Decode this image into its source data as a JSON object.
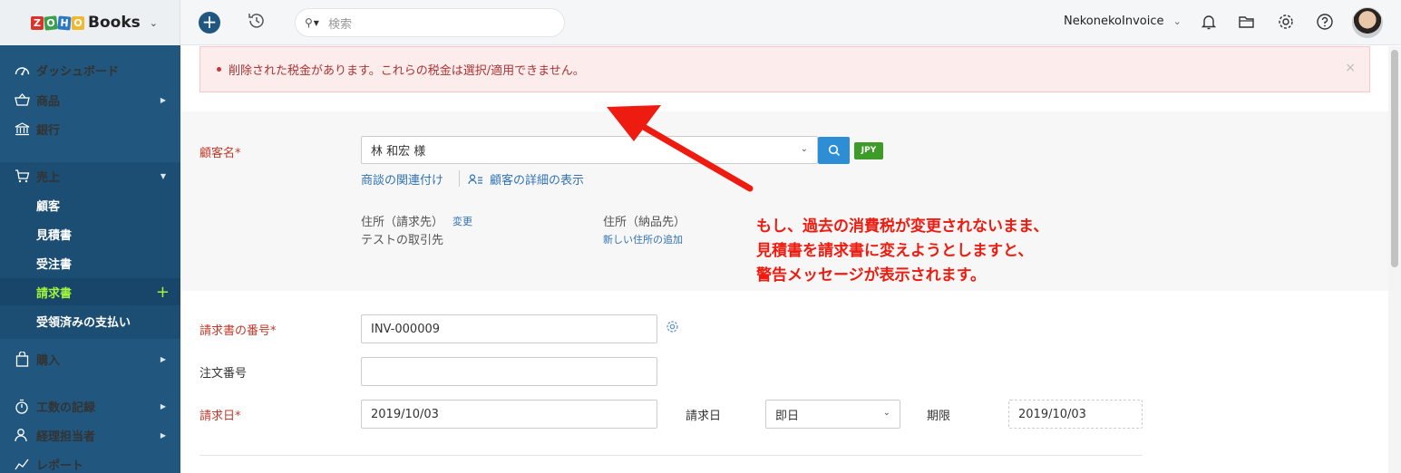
{
  "brand": {
    "logo_letters": [
      "Z",
      "O",
      "H",
      "O"
    ],
    "name": "Books"
  },
  "topbar": {
    "search_placeholder": "検索",
    "organization": "NekonekoInvoice"
  },
  "sidebar": {
    "dashboard": "ダッシュボード",
    "items": "商品",
    "banking": "銀行",
    "sales": "売上",
    "customers": "顧客",
    "estimates": "見積書",
    "sales_orders": "受注書",
    "invoices": "請求書",
    "payments_received": "受領済みの支払い",
    "purchases": "購入",
    "time_tracking": "工数の記録",
    "accountant": "経理担当者",
    "reports": "レポート"
  },
  "alert": {
    "message": "削除された税金があります。これらの税金は選択/適用できません。",
    "close": "×"
  },
  "form": {
    "customer_label": "顧客名*",
    "customer_value": "林 和宏 様",
    "currency_badge": "JPY",
    "link_deals": "商談の関連付け",
    "link_customer_details": "顧客の詳細の表示",
    "billing_address_label": "住所（請求先）",
    "billing_address_change": "変更",
    "billing_address_value": "テストの取引先",
    "shipping_address_label": "住所（納品先）",
    "shipping_address_add": "新しい住所の追加",
    "invoice_number_label": "請求書の番号*",
    "invoice_number_value": "INV-000009",
    "order_number_label": "注文番号",
    "order_number_value": "",
    "invoice_date_label": "請求日*",
    "invoice_date_value": "2019/10/03",
    "terms_label": "請求日",
    "terms_value": "即日",
    "due_date_label": "期限",
    "due_date_value": "2019/10/03"
  },
  "annotation": {
    "line1": "もし、過去の消費税が変更されないまま、",
    "line2": "見積書を請求書に変えようとしますと、",
    "line3": "警告メッセージが表示されます。"
  },
  "colors": {
    "sidebar": "#21577f",
    "active_text": "#9ff53b",
    "required": "#c0392b",
    "link": "#3173b7",
    "annotation": "#ee1c10"
  }
}
